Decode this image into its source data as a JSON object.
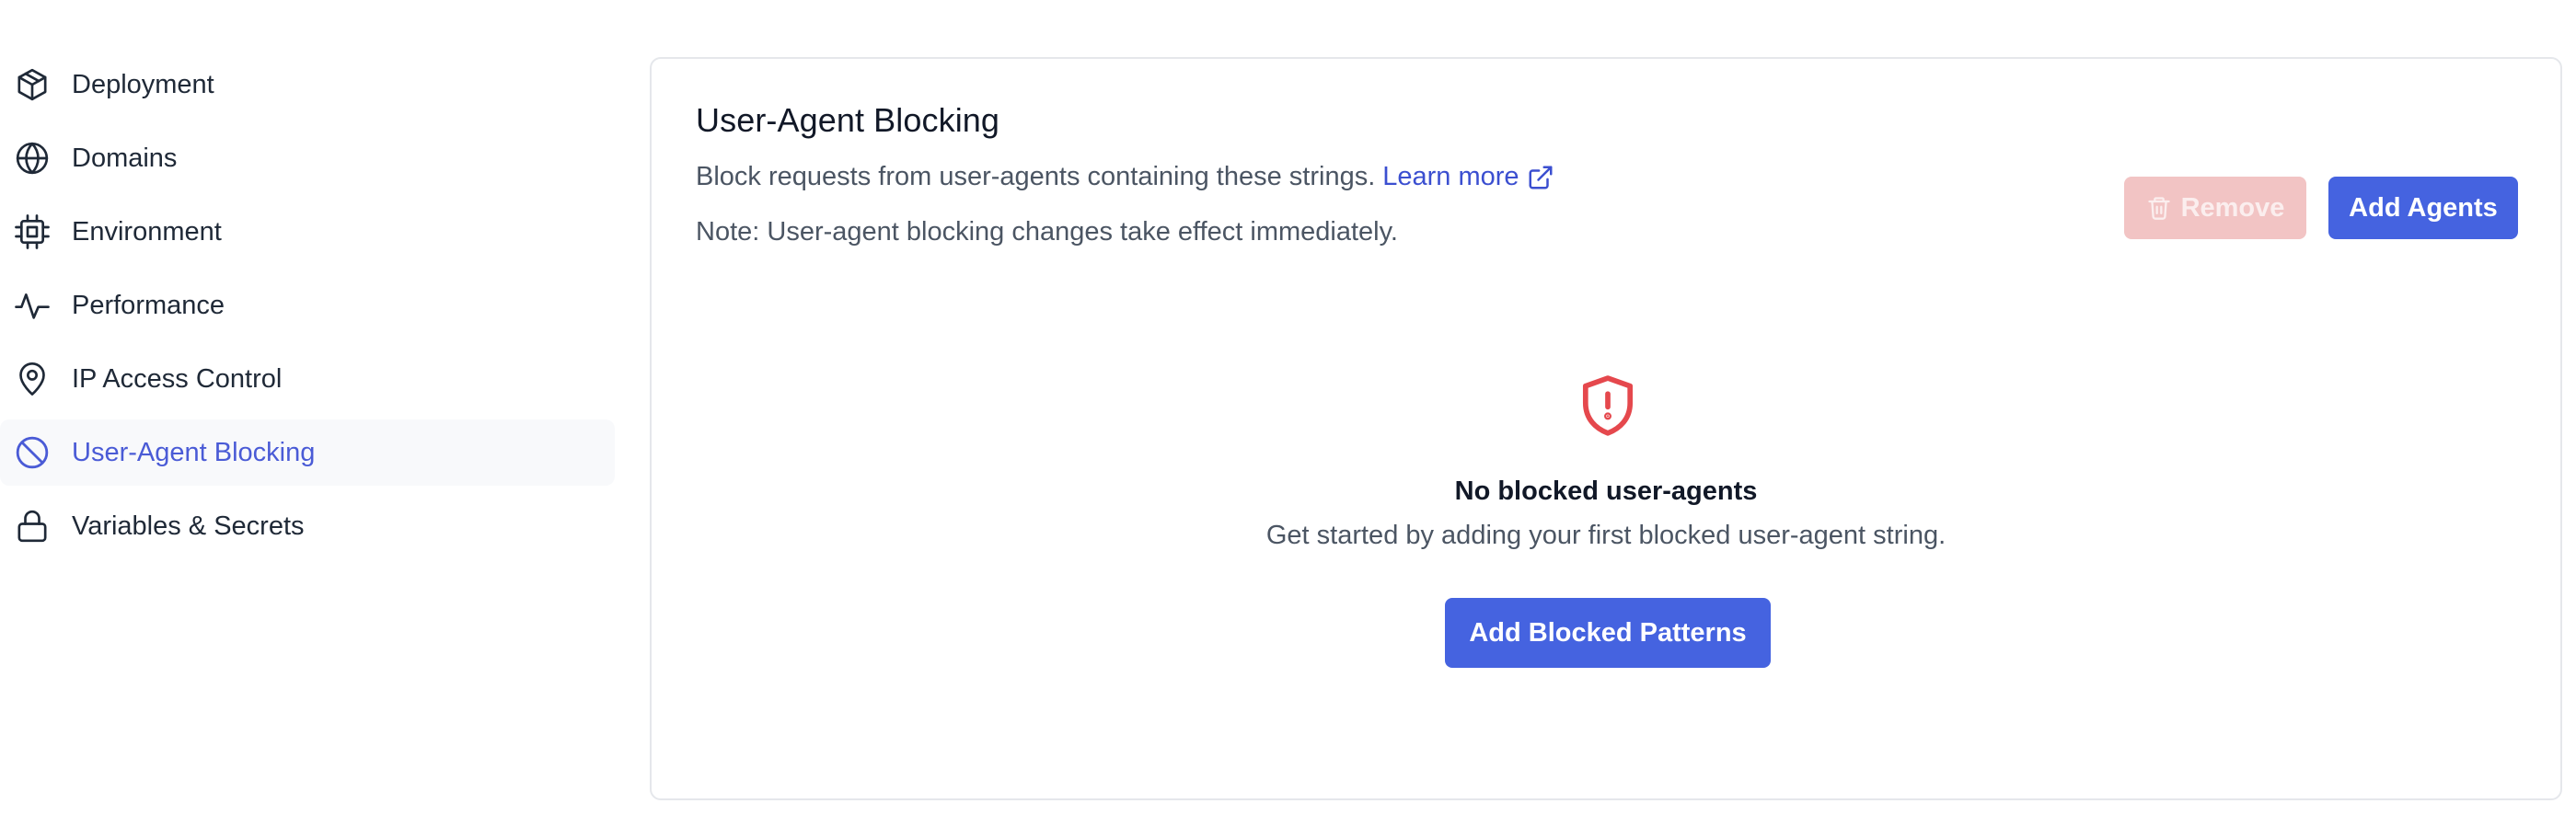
{
  "sidebar": {
    "items": [
      {
        "label": "Deployment",
        "icon": "package-icon",
        "active": false
      },
      {
        "label": "Domains",
        "icon": "globe-icon",
        "active": false
      },
      {
        "label": "Environment",
        "icon": "cpu-icon",
        "active": false
      },
      {
        "label": "Performance",
        "icon": "activity-icon",
        "active": false
      },
      {
        "label": "IP Access Control",
        "icon": "map-pin-icon",
        "active": false
      },
      {
        "label": "User-Agent Blocking",
        "icon": "ban-icon",
        "active": true
      },
      {
        "label": "Variables & Secrets",
        "icon": "lock-icon",
        "active": false
      }
    ]
  },
  "panel": {
    "title": "User-Agent Blocking",
    "description": "Block requests from user-agents containing these strings.",
    "learn_more": "Learn more",
    "note": "Note: User-agent blocking changes take effect immediately.",
    "remove_label": "Remove",
    "add_label": "Add Agents"
  },
  "empty_state": {
    "icon": "shield-alert-icon",
    "title": "No blocked user-agents",
    "subtitle": "Get started by adding your first blocked user-agent string.",
    "button_label": "Add Blocked Patterns"
  },
  "colors": {
    "accent": "#4563e0",
    "active_nav_text": "#4a5bd6",
    "danger_icon": "#e5484d",
    "remove_disabled_bg": "#f2c4c4"
  }
}
